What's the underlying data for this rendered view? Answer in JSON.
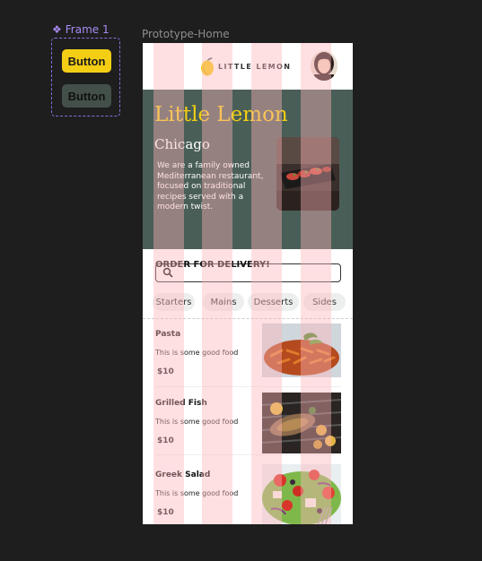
{
  "canvas": {
    "component_frame": {
      "label": "Frame 1",
      "icon": "component-diamond-icon"
    },
    "buttons": {
      "primary_label": "Button",
      "secondary_label": "Button"
    },
    "prototype_label": "Prototype-Home"
  },
  "colors": {
    "canvas_bg": "#1e1e1e",
    "primary_yellow": "#f4ce14",
    "primary_green": "#495e57",
    "grid_overlay": "#ffb6b9",
    "frame_accent": "#a98bf2"
  },
  "app": {
    "logo_text": "LITTLE LEMON",
    "hero": {
      "title": "Little Lemon",
      "city": "Chicago",
      "description": "We are a family owned Mediterranean restaurant, focused on traditional recipes served with a modern twist.",
      "search_placeholder": ""
    },
    "order_heading": "ORDER FOR DELIVERY!",
    "categories": [
      "Starters",
      "Mains",
      "Desserts",
      "Sides"
    ],
    "menu": [
      {
        "name": "Pasta",
        "description": "This is some good food",
        "price": "$10"
      },
      {
        "name": "Grilled Fish",
        "description": "This is some good food",
        "price": "$10"
      },
      {
        "name": "Greek Salad",
        "description": "This is some good food",
        "price": "$10"
      }
    ]
  }
}
